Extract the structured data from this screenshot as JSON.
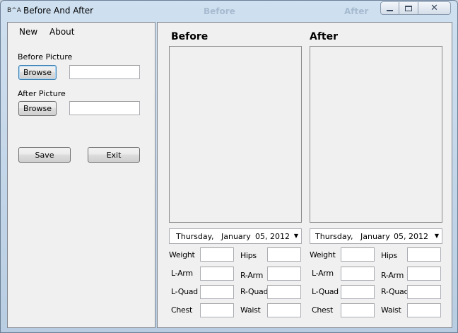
{
  "window": {
    "icon_text": "B^A",
    "title": "Before And After",
    "ghost_before": "Before",
    "ghost_after": "After"
  },
  "menu": {
    "items": [
      "New",
      "About"
    ]
  },
  "left": {
    "before_picture_label": "Before Picture",
    "after_picture_label": "After Picture",
    "browse_label": "Browse",
    "before_path": "",
    "after_path": "",
    "save_label": "Save",
    "exit_label": "Exit"
  },
  "before": {
    "heading": "Before",
    "date": {
      "weekday": "Thursday",
      "sep": ",",
      "month": "January",
      "day_year": "05, 2012"
    },
    "fields": {
      "weight": "Weight",
      "hips": "Hips",
      "l_arm": "L-Arm",
      "r_arm": "R-Arm",
      "l_quad": "L-Quad",
      "r_quad": "R-Quad",
      "chest": "Chest",
      "waist": "Waist"
    },
    "values": {
      "weight": "",
      "hips": "",
      "l_arm": "",
      "r_arm": "",
      "l_quad": "",
      "r_quad": "",
      "chest": "",
      "waist": ""
    }
  },
  "after": {
    "heading": "After",
    "date": {
      "weekday": "Thursday",
      "sep": ",",
      "month": "January",
      "day_year": "05, 2012"
    },
    "fields": {
      "weight": "Weight",
      "hips": "Hips",
      "l_arm": "L-Arm",
      "r_arm": "R-Arm",
      "l_quad": "L-Quad",
      "r_quad": "R-Quad",
      "chest": "Chest",
      "waist": "Waist"
    },
    "values": {
      "weight": "",
      "hips": "",
      "l_arm": "",
      "r_arm": "",
      "l_quad": "",
      "r_quad": "",
      "chest": "",
      "waist": ""
    }
  },
  "icons": {
    "dropdown": "chevron-down-icon",
    "minimize": "minimize-icon",
    "maximize": "maximize-icon",
    "close": "close-icon"
  }
}
